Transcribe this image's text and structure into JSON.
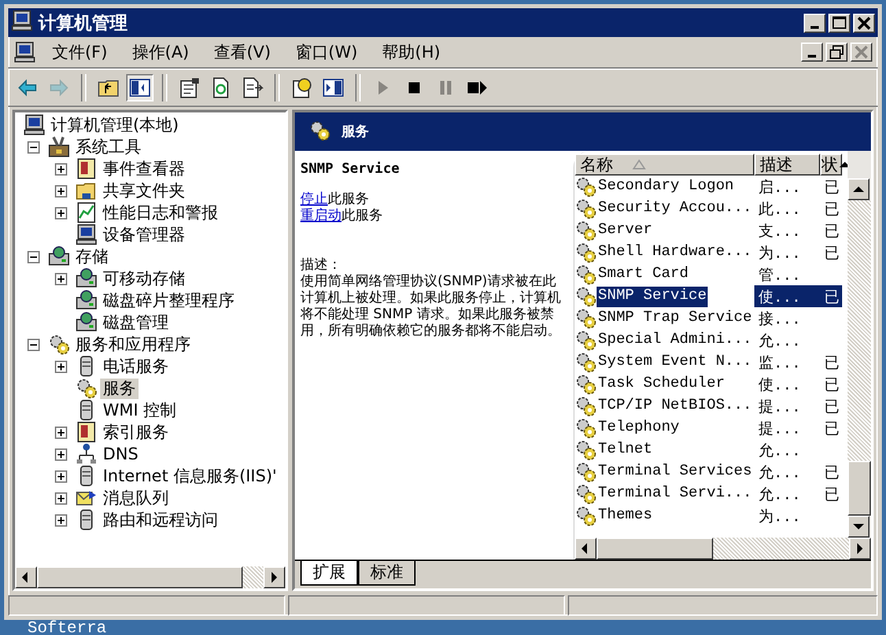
{
  "window": {
    "title": "计算机管理"
  },
  "menu": [
    "文件(F)",
    "操作(A)",
    "查看(V)",
    "窗口(W)",
    "帮助(H)"
  ],
  "toolbar": [
    {
      "kind": "back",
      "disabled": false
    },
    {
      "kind": "forward",
      "disabled": true
    },
    {
      "kind": "separator"
    },
    {
      "kind": "up",
      "disabled": false
    },
    {
      "kind": "tree",
      "disabled": false,
      "pressed": true
    },
    {
      "kind": "separator"
    },
    {
      "kind": "properties",
      "disabled": false
    },
    {
      "kind": "refresh",
      "disabled": false
    },
    {
      "kind": "export",
      "disabled": false
    },
    {
      "kind": "separator"
    },
    {
      "kind": "help",
      "disabled": false
    },
    {
      "kind": "panel",
      "disabled": false
    },
    {
      "kind": "separator"
    },
    {
      "kind": "play",
      "disabled": true
    },
    {
      "kind": "stop",
      "disabled": false
    },
    {
      "kind": "pause",
      "disabled": true
    },
    {
      "kind": "restart",
      "disabled": false
    }
  ],
  "tree": [
    {
      "label": "计算机管理(本地)",
      "selected": false,
      "children": [
        {
          "label": "系统工具",
          "expanded": true,
          "selected": false,
          "children": [
            {
              "label": "事件查看器",
              "expanded": false,
              "selected": false
            },
            {
              "label": "共享文件夹",
              "expanded": false,
              "selected": false
            },
            {
              "label": "性能日志和警报",
              "expanded": false,
              "selected": false
            },
            {
              "label": "设备管理器",
              "selected": false
            }
          ]
        },
        {
          "label": "存储",
          "expanded": true,
          "selected": false,
          "children": [
            {
              "label": "可移动存储",
              "expanded": false,
              "selected": false
            },
            {
              "label": "磁盘碎片整理程序",
              "selected": false
            },
            {
              "label": "磁盘管理",
              "selected": false
            }
          ]
        },
        {
          "label": "服务和应用程序",
          "expanded": true,
          "selected": false,
          "children": [
            {
              "label": "电话服务",
              "expanded": false,
              "selected": false
            },
            {
              "label": "服务",
              "selected": true
            },
            {
              "label": "WMI 控制",
              "selected": false
            },
            {
              "label": "索引服务",
              "expanded": false,
              "selected": false
            },
            {
              "label": "DNS",
              "expanded": false,
              "selected": false
            },
            {
              "label": "Internet 信息服务(IIS)'",
              "expanded": false,
              "selected": false
            },
            {
              "label": "消息队列",
              "expanded": false,
              "selected": false
            },
            {
              "label": "路由和远程访问",
              "expanded": false,
              "selected": false
            }
          ]
        }
      ]
    }
  ],
  "detail": {
    "header": "服务",
    "service_name": "SNMP Service",
    "actions": [
      {
        "link": "停止",
        "text": "此服务"
      },
      {
        "link": "重启动",
        "text": "此服务"
      }
    ],
    "description_label": "描述：",
    "description": "使用简单网络管理协议(SNMP)请求被在此计算机上被处理。如果此服务停止，计算机将不能处理 SNMP 请求。如果此服务被禁用，所有明确依赖它的服务都将不能启动。"
  },
  "services": {
    "columns": [
      "名称",
      "描述",
      "状"
    ],
    "rows": [
      {
        "name": "Secondary Logon",
        "description": "启...",
        "status": "已",
        "selected": false
      },
      {
        "name": "Security Accou...",
        "description": "此...",
        "status": "已",
        "selected": false
      },
      {
        "name": "Server",
        "description": "支...",
        "status": "已",
        "selected": false
      },
      {
        "name": "Shell Hardware...",
        "description": "为...",
        "status": "已",
        "selected": false
      },
      {
        "name": "Smart Card",
        "description": "管...",
        "selected": false
      },
      {
        "name": "SNMP Service",
        "description": "使...",
        "status": "已",
        "selected": true
      },
      {
        "name": "SNMP Trap Service",
        "description": "接...",
        "selected": false
      },
      {
        "name": "Special Admini...",
        "description": "允...",
        "selected": false
      },
      {
        "name": "System Event N...",
        "description": "监...",
        "status": "已",
        "selected": false
      },
      {
        "name": "Task Scheduler",
        "description": "使...",
        "status": "已",
        "selected": false
      },
      {
        "name": "TCP/IP NetBIOS...",
        "description": "提...",
        "status": "已",
        "selected": false
      },
      {
        "name": "Telephony",
        "description": "提...",
        "status": "已",
        "selected": false
      },
      {
        "name": "Telnet",
        "description": "允...",
        "selected": false
      },
      {
        "name": "Terminal Services",
        "description": "允...",
        "status": "已",
        "selected": false
      },
      {
        "name": "Terminal Servi...",
        "description": "允...",
        "status": "已",
        "selected": false
      },
      {
        "name": "Themes",
        "description": "为...",
        "selected": false
      }
    ]
  },
  "view_tabs": [
    {
      "label": "扩展",
      "selected": true
    },
    {
      "label": "标准",
      "selected": false
    }
  ],
  "desktop_label": "Softerra"
}
